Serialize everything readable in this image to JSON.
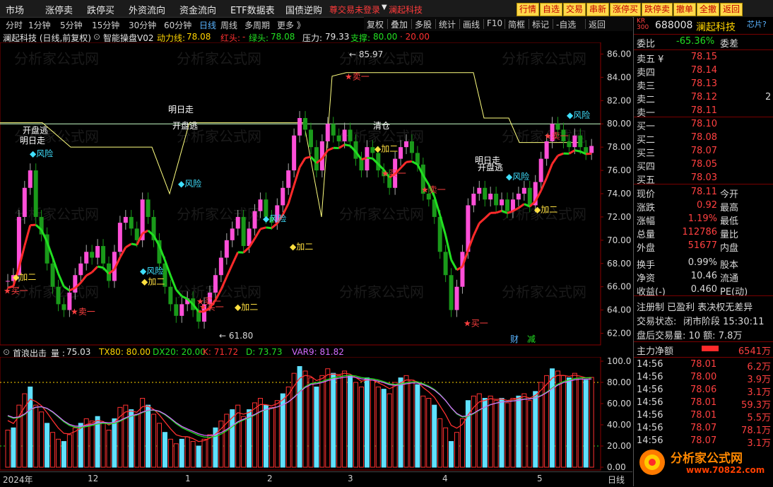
{
  "menu": {
    "items": [
      "市场",
      "涨停卖",
      "跌停买",
      "外资流向",
      "资金流向",
      "ETF数据表",
      "国债逆购"
    ],
    "warning": "尊交易未登录",
    "arrow": "▼",
    "stock_tab": "澜起科技",
    "buttons": [
      "行情",
      "自选",
      "交易",
      "串新",
      "涨停买",
      "跌停卖",
      "撤单",
      "全撤",
      "返回"
    ]
  },
  "toolbar": {
    "title": "澜起科技 (日线,前复权)",
    "items": [
      "复权",
      "叠加",
      "多股",
      "统计",
      "画线",
      "F10",
      "简框",
      "标记",
      "-自选",
      "返回"
    ]
  },
  "periods": {
    "items": [
      "分时",
      "1分钟",
      "5分钟",
      "15分钟",
      "30分钟",
      "60分钟",
      "日线",
      "周线",
      "多周期",
      "更多 》"
    ],
    "active_index": 6
  },
  "main_legend": {
    "indicator": "智能操盘V02",
    "power_label": "动力线:",
    "power_value": "78.08",
    "red_label": "红头:",
    "red_value": "-",
    "green_label": "绿头:",
    "green_value": "78.08",
    "pressure_label": "压力:",
    "pressure_value": "79.33",
    "support_label": "支撑:",
    "support_value": "80.00",
    "extra": "· 20.00"
  },
  "sub_legend": {
    "indicator": "首浪出击_量 :",
    "value": "75.03",
    "tx80": "TX80: 80.00",
    "dx20": "DX20: 20.00",
    "k": "K: 71.72",
    "d": "D: 73.73",
    "var9": "VAR9: 81.82"
  },
  "price_axis": [
    "86.00",
    "84.00",
    "82.00",
    "80.00",
    "78.00",
    "76.00",
    "74.00",
    "72.00",
    "70.00",
    "68.00",
    "66.00",
    "64.00",
    "62.00"
  ],
  "osc_axis": [
    "100.0",
    "80.00",
    "60.00",
    "40.00",
    "20.00",
    "0.00"
  ],
  "date_axis": {
    "labels": [
      "2024年",
      "12",
      "1",
      "2",
      "3",
      "4",
      "5"
    ],
    "period_tag": "日线"
  },
  "chart_annotations": {
    "high_label": "85.97",
    "low_label": "61.80",
    "signals": [
      "开盘逃",
      "明日走",
      "风险",
      "加二",
      "买一",
      "卖一",
      "风险",
      "加二",
      "买一",
      "明日走",
      "开盘逃",
      "风险",
      "加二",
      "买一",
      "风险",
      "加二",
      "卖一",
      "清仓",
      "买一",
      "加二",
      "明日走",
      "开盘逃",
      "风险",
      "加二",
      "买一",
      "卖一",
      "风险",
      "卖一"
    ],
    "watermark": "分析家公式网",
    "bottom_tags": [
      "财",
      "减"
    ],
    "site_watermark": "分析家公式网",
    "site_url": "www.70822.com"
  },
  "chart_data": {
    "type": "line",
    "title": "",
    "xlabel": "",
    "ylabel": "",
    "ylim": [
      61,
      87
    ],
    "candles_close": [
      66.5,
      67.0,
      72.0,
      74.5,
      76.0,
      72.0,
      70.5,
      68.0,
      66.0,
      64.5,
      64.0,
      65.5,
      67.0,
      68.0,
      69.0,
      68.5,
      69.5,
      68.0,
      66.5,
      69.0,
      71.5,
      72.0,
      71.0,
      70.0,
      73.5,
      72.0,
      70.0,
      68.0,
      66.0,
      64.5,
      63.5,
      64.5,
      65.0,
      64.0,
      63.0,
      64.5,
      65.5,
      67.0,
      68.5,
      70.0,
      71.0,
      72.0,
      69.5,
      71.0,
      72.5,
      73.5,
      72.0,
      71.5,
      73.0,
      74.5,
      76.0,
      79.0,
      80.5,
      79.5,
      78.0,
      76.0,
      78.5,
      80.0,
      79.0,
      78.5,
      79.5,
      78.5,
      77.0,
      76.0,
      78.0,
      77.5,
      76.0,
      75.5,
      74.5,
      77.0,
      78.0,
      78.5,
      77.5,
      76.5,
      74.0,
      73.5,
      72.0,
      69.0,
      67.0,
      64.0,
      66.0,
      69.0,
      73.0,
      74.0,
      74.5,
      73.5,
      74.0,
      73.0,
      73.5,
      72.5,
      73.5,
      74.0,
      74.5,
      73.0,
      75.0,
      77.0,
      78.5,
      80.0,
      79.5,
      78.5,
      78.0,
      79.0,
      78.0,
      77.5,
      78.1
    ],
    "series": []
  },
  "right_panel": {
    "code_prefix": "KR 300",
    "code": "688008",
    "name": "澜起科技",
    "chip": "芯片?",
    "weibi_label": "委比",
    "weibi_value": "-65.36%",
    "weicha_label": "委差",
    "asks": [
      {
        "label": "卖五 ¥",
        "price": "78.15"
      },
      {
        "label": "卖四",
        "price": "78.14"
      },
      {
        "label": "卖三",
        "price": "78.13"
      },
      {
        "label": "卖二",
        "price": "78.12"
      },
      {
        "label": "卖一",
        "price": "78.11"
      }
    ],
    "bids": [
      {
        "label": "买一",
        "price": "78.10"
      },
      {
        "label": "买二",
        "price": "78.08"
      },
      {
        "label": "买三",
        "price": "78.07"
      },
      {
        "label": "买四",
        "price": "78.05"
      },
      {
        "label": "买五",
        "price": "78.03"
      }
    ],
    "ask2_extra": "2",
    "stats": [
      {
        "l": "现价",
        "v": "78.11",
        "r": "今开"
      },
      {
        "l": "涨跌",
        "v": "0.92",
        "r": "最高"
      },
      {
        "l": "涨幅",
        "v": "1.19%",
        "r": "最低"
      },
      {
        "l": "总量",
        "v": "112786",
        "r": "量比"
      },
      {
        "l": "外盘",
        "v": "51677",
        "r": "内盘"
      },
      {
        "l": "换手",
        "v": "0.99%",
        "r": "股本"
      },
      {
        "l": "净资",
        "v": "10.46",
        "r": "流通"
      },
      {
        "l": "收益(-)",
        "v": "0.460",
        "r": "PE(动)"
      }
    ],
    "flags": "注册制 已盈利 表决权无差异",
    "trade_status_label": "交易状态:",
    "trade_status": "闭市阶段 15:30:11",
    "after_hours": "盘后交易量: 10  额: 7.8万",
    "mainflow_label": "主力净额",
    "mainflow_value": "6541万",
    "ticks": [
      {
        "t": "14:56",
        "p": "78.01",
        "v": "6.2万"
      },
      {
        "t": "14:56",
        "p": "78.00",
        "v": "3.9万"
      },
      {
        "t": "14:56",
        "p": "78.06",
        "v": "3.1万"
      },
      {
        "t": "14:56",
        "p": "78.01",
        "v": "59.3万"
      },
      {
        "t": "14:56",
        "p": "78.01",
        "v": "5.5万"
      },
      {
        "t": "14:56",
        "p": "78.07",
        "v": "78.1万"
      },
      {
        "t": "14:56",
        "p": "78.07",
        "v": "3.1万"
      }
    ],
    "logo_text": "分析家公式网",
    "logo_url": "www.70822.com"
  },
  "colors": {
    "up": "#ff4fd8",
    "down": "#1a9a1a",
    "flat_cyan": "#45d3e8",
    "line_up": "#ff2a2a",
    "line_down": "#21e021",
    "line_mid": "#ffd400"
  }
}
